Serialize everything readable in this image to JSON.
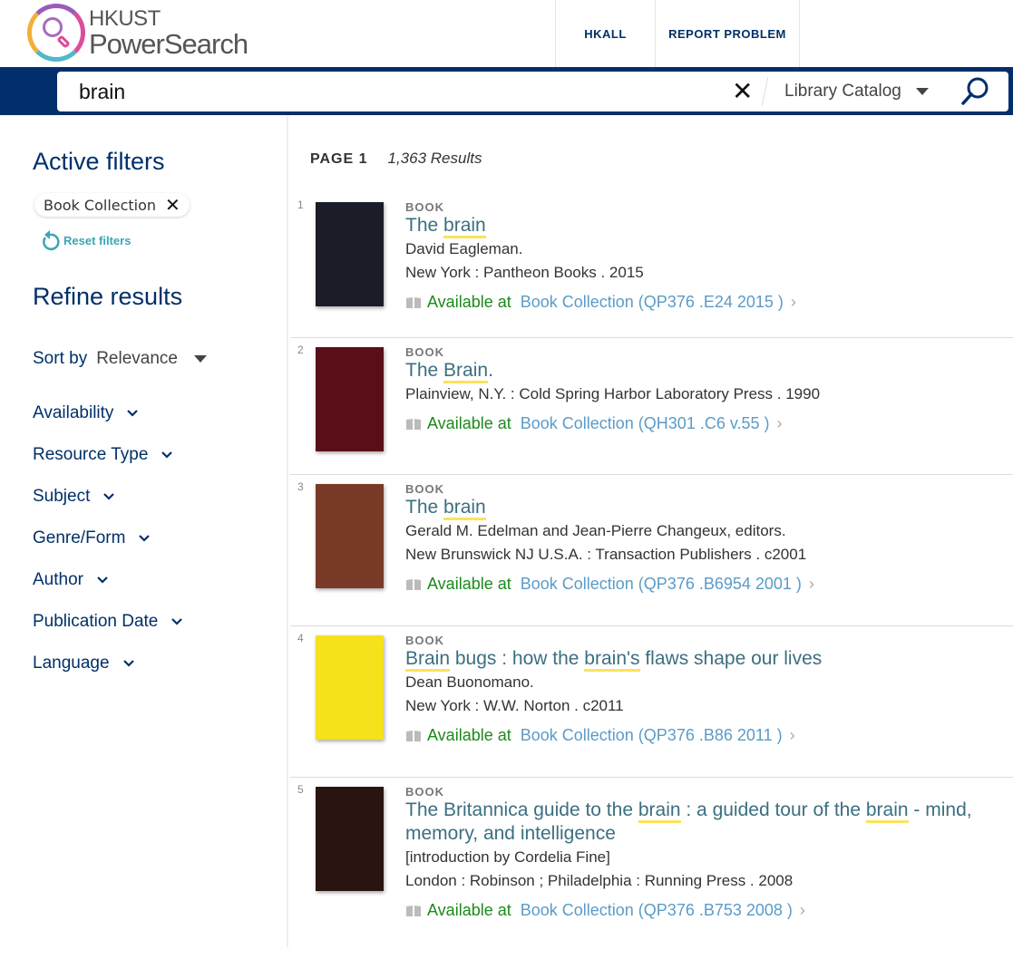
{
  "header": {
    "logo_line1": "HKUST",
    "logo_line2": "PowerSearch",
    "nav": [
      "HKALL",
      "REPORT PROBLEM"
    ]
  },
  "search": {
    "query": "brain",
    "scope": "Library Catalog"
  },
  "colors": {
    "brand": "#002f6c",
    "available": "#1c8a1c",
    "link": "#5b9bc8",
    "title": "#3c6f80",
    "highlight": "#fde25b"
  },
  "sidebar": {
    "active_filters_title": "Active filters",
    "active_filter_chip": "Book Collection",
    "reset_label": "Reset filters",
    "refine_title": "Refine results",
    "sort_label": "Sort by",
    "sort_value": "Relevance",
    "facets": [
      "Availability",
      "Resource Type",
      "Subject",
      "Genre/Form",
      "Author",
      "Publication Date",
      "Language"
    ]
  },
  "results_header": {
    "page": "PAGE 1",
    "count": "1,363 Results"
  },
  "results": [
    {
      "num": "1",
      "type": "BOOK",
      "cover_color": "#1a1d28",
      "title": [
        {
          "t": "The "
        },
        {
          "t": "brain",
          "hl": true
        }
      ],
      "lines": [
        "David Eagleman.",
        "New York : Pantheon Books . 2015"
      ],
      "available": "Available at",
      "location": "Book Collection (QP376 .E24 2015 )"
    },
    {
      "num": "2",
      "type": "BOOK",
      "cover_color": "#5a0f18",
      "title": [
        {
          "t": "The "
        },
        {
          "t": "Brain",
          "hl": true
        },
        {
          "t": "."
        }
      ],
      "lines": [
        "Plainview, N.Y. : Cold Spring Harbor Laboratory Press . 1990"
      ],
      "available": "Available at",
      "location": "Book Collection (QH301 .C6 v.55 )"
    },
    {
      "num": "3",
      "type": "BOOK",
      "cover_color": "#7a3a28",
      "title": [
        {
          "t": "The "
        },
        {
          "t": "brain",
          "hl": true
        }
      ],
      "lines": [
        "Gerald M. Edelman and Jean-Pierre Changeux, editors.",
        "New Brunswick NJ U.S.A. : Transaction Publishers . c2001"
      ],
      "available": "Available at",
      "location": "Book Collection (QP376 .B6954 2001 )"
    },
    {
      "num": "4",
      "type": "BOOK",
      "cover_color": "#f5e21a",
      "title": [
        {
          "t": "Brain",
          "hl": true
        },
        {
          "t": " bugs : how the "
        },
        {
          "t": "brain's",
          "hl": true
        },
        {
          "t": " flaws shape our lives"
        }
      ],
      "lines": [
        "Dean Buonomano.",
        "New York : W.W. Norton . c2011"
      ],
      "available": "Available at",
      "location": "Book Collection (QP376 .B86 2011 )"
    },
    {
      "num": "5",
      "type": "BOOK",
      "cover_color": "#2a1410",
      "title": [
        {
          "t": "The Britannica guide to the "
        },
        {
          "t": "brain",
          "hl": true
        },
        {
          "t": " : a guided tour of the "
        },
        {
          "t": "brain",
          "hl": true
        },
        {
          "t": " - mind, memory, and intelligence"
        }
      ],
      "lines": [
        "[introduction by Cordelia Fine]",
        "London : Robinson ; Philadelphia : Running Press . 2008"
      ],
      "available": "Available at",
      "location": "Book Collection (QP376 .B753 2008 )"
    }
  ]
}
